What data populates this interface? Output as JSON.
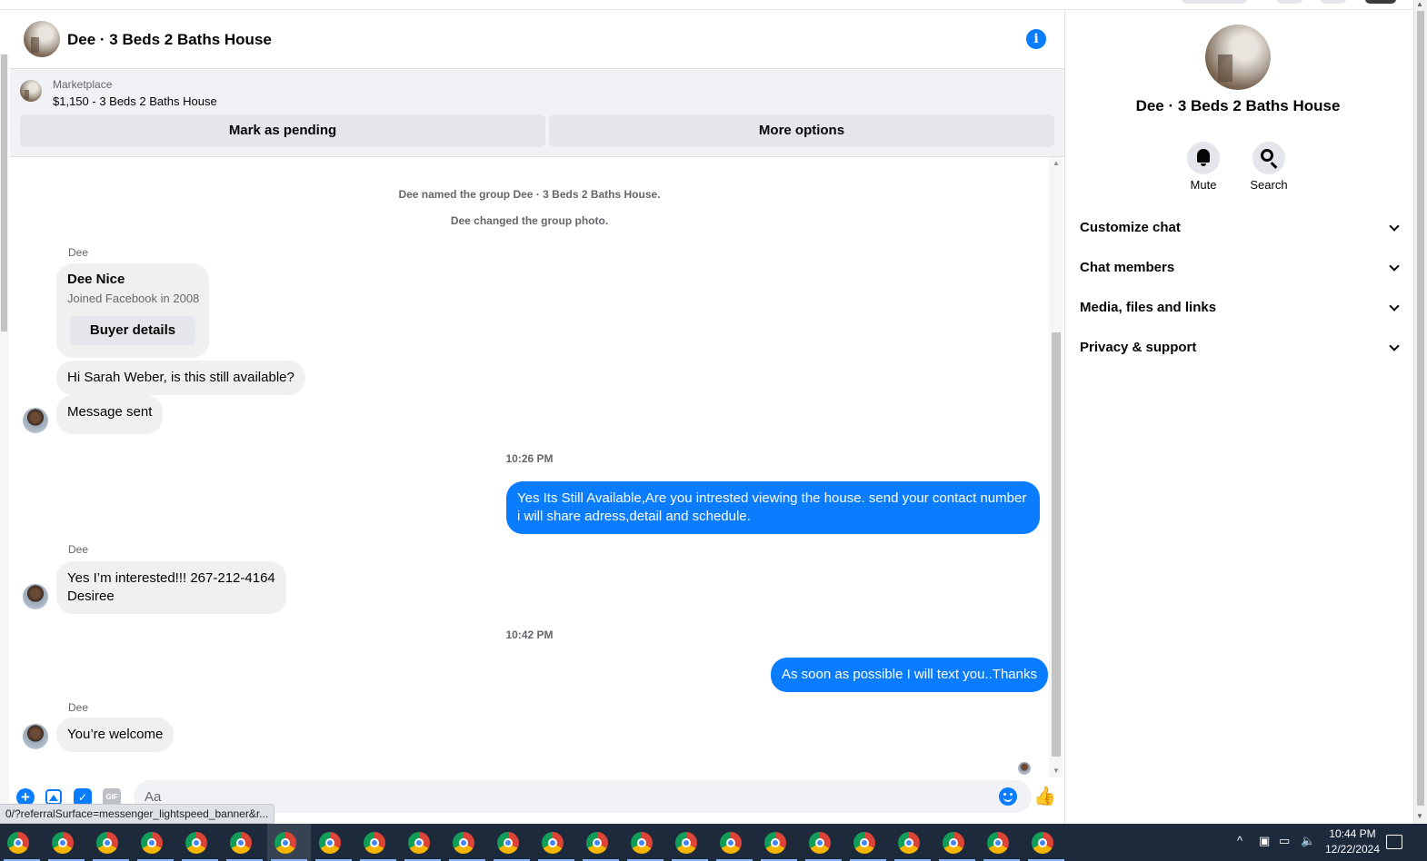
{
  "header": {
    "title": "Dee · 3 Beds 2 Baths House",
    "info_icon": "i"
  },
  "marketplace": {
    "label": "Marketplace",
    "listing": "$1,150 - 3 Beds 2 Baths House",
    "mark_pending": "Mark as pending",
    "more_options": "More options"
  },
  "messages": {
    "system_1": "Dee named the group Dee · 3 Beds 2 Baths House.",
    "system_2": "Dee changed the group photo.",
    "sender": "Dee",
    "card": {
      "name": "Dee Nice",
      "subtitle": "Joined Facebook in 2008",
      "button": "Buyer details"
    },
    "incoming_1": "Hi Sarah Weber, is this still available?",
    "incoming_2": "Message sent",
    "time_1": "10:26 PM",
    "outgoing_1": "Yes Its Still Available,Are you intrested viewing the house. send your contact number i will share adress,detail and schedule.",
    "incoming_3_line1": "Yes I’m interested!!! 267-212-4164",
    "incoming_3_line2": "Desiree",
    "time_2": "10:42 PM",
    "outgoing_2": "As soon as possible I will text you..Thanks",
    "incoming_4": "You’re welcome"
  },
  "composer": {
    "placeholder": "Aa",
    "gif_label": "GIF"
  },
  "status_url": "0/?referralSurface=messenger_lightspeed_banner&r...",
  "panel": {
    "title": "Dee · 3 Beds 2 Baths House",
    "mute": "Mute",
    "search": "Search",
    "sections": [
      "Customize chat",
      "Chat members",
      "Media, files and links",
      "Privacy & support"
    ]
  },
  "taskbar": {
    "time": "10:44 PM",
    "date": "12/22/2024",
    "app_count": 24,
    "active_index": 6
  },
  "colors": {
    "accent": "#0a7cff",
    "bubble_in": "#f0f0f0",
    "taskbar": "#1c2a3c"
  }
}
